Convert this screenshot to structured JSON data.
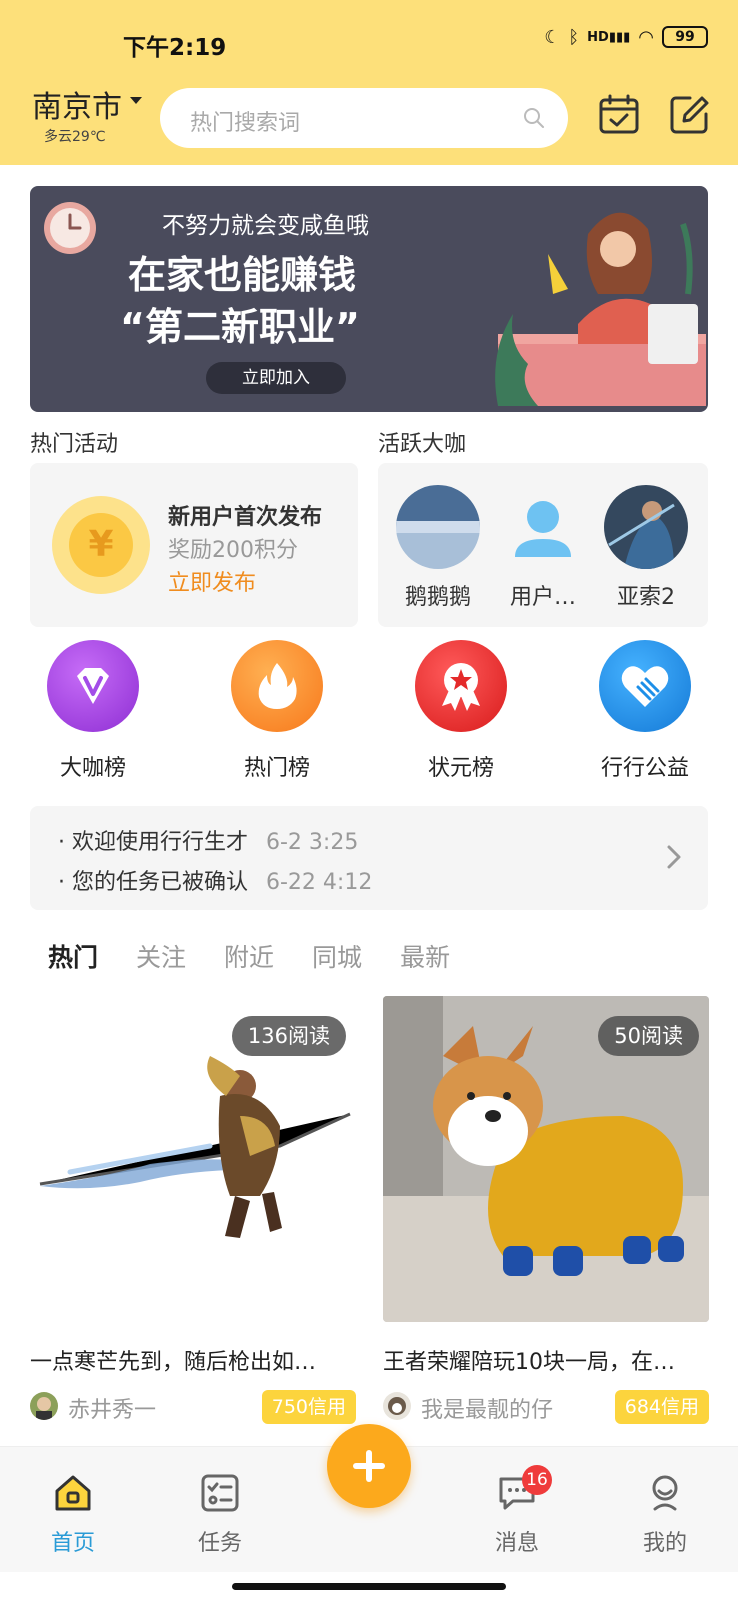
{
  "status_bar": {
    "time": "下午2:19",
    "battery": "99",
    "network": "HD"
  },
  "header": {
    "city": "南京市",
    "weather": "多云29℃",
    "search_placeholder": "热门搜索词"
  },
  "banner": {
    "subtitle": "不努力就会变咸鱼哦",
    "line1": "在家也能赚钱",
    "line2": "“第二新职业”",
    "button": "立即加入"
  },
  "sections": {
    "activities": "热门活动",
    "users": "活跃大咖"
  },
  "activity": {
    "coin_symbol": "¥",
    "title": "新用户首次发布",
    "subtitle": "奖励200积分",
    "link": "立即发布"
  },
  "active_users": [
    {
      "name": "鹅鹅鹅"
    },
    {
      "name": "用户…"
    },
    {
      "name": "亚索2"
    }
  ],
  "rankings": [
    {
      "label": "大咖榜",
      "icon": "diamond-v-icon",
      "color": "#a34de8"
    },
    {
      "label": "热门榜",
      "icon": "flame-icon",
      "color": "#fb8a1e"
    },
    {
      "label": "状元榜",
      "icon": "medal-icon",
      "color": "#ee2b2b"
    },
    {
      "label": "行行公益",
      "icon": "heart-hands-icon",
      "color": "#1d8fe8"
    }
  ],
  "notices": [
    {
      "text": "· 欢迎使用行行生才",
      "time": "6-2 3:25"
    },
    {
      "text": "· 您的任务已被确认",
      "time": "6-22 4:12"
    }
  ],
  "tabs": [
    {
      "label": "热门",
      "active": true
    },
    {
      "label": "关注"
    },
    {
      "label": "附近"
    },
    {
      "label": "同城"
    },
    {
      "label": "最新"
    }
  ],
  "feed": [
    {
      "reads": "136阅读",
      "title": "一点寒芒先到，随后枪出如…",
      "author": "赤井秀一",
      "credit": "750信用"
    },
    {
      "reads": "50阅读",
      "title": "王者荣耀陪玩10块一局，在…",
      "author": "我是最靓的仔",
      "credit": "684信用"
    }
  ],
  "bottom_nav": [
    {
      "label": "首页",
      "active": true
    },
    {
      "label": "任务"
    },
    {
      "label": "消息",
      "badge": "16"
    },
    {
      "label": "我的"
    }
  ],
  "colors": {
    "header": "#fde07a",
    "accent_blue": "#2a9bd6",
    "accent_orange": "#fca91c",
    "credit_yellow": "#fcd43d"
  }
}
